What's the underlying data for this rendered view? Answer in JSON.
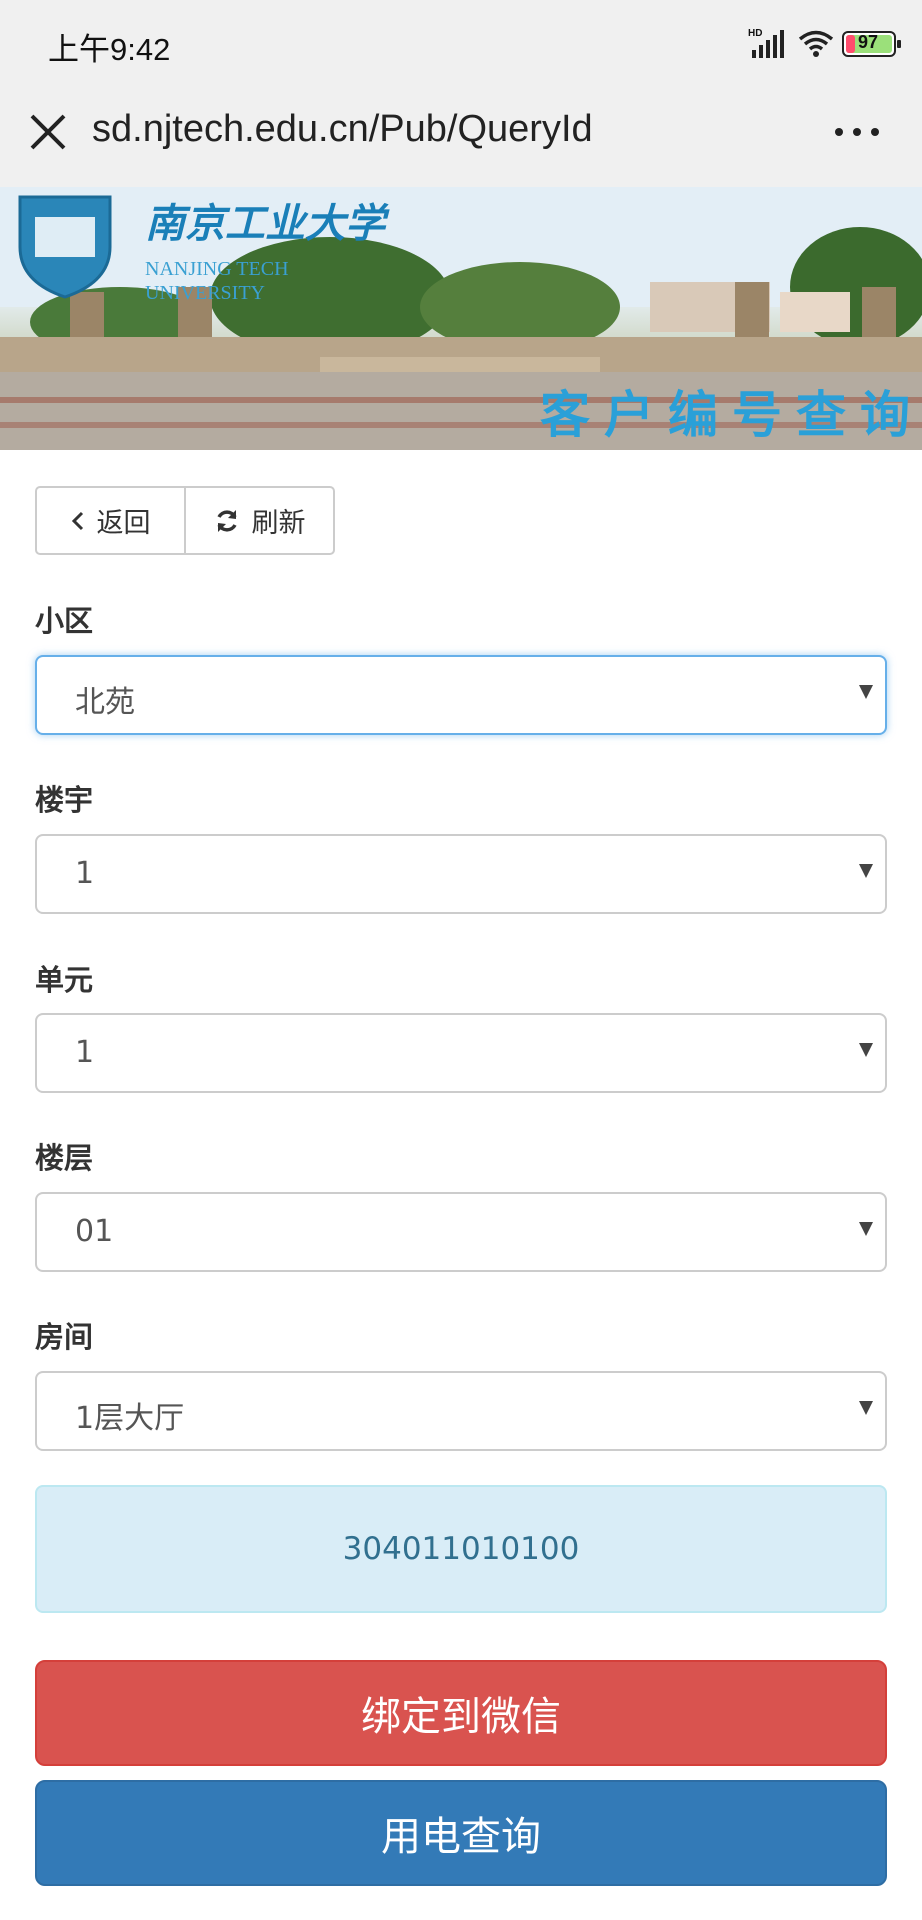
{
  "status_bar": {
    "time": "上午9:42",
    "signal_label": "HD",
    "battery": "97"
  },
  "browser": {
    "url": "sd.njtech.edu.cn/Pub/QueryId",
    "close_icon": "close-icon",
    "more_icon": "more-dots-icon"
  },
  "banner": {
    "school_name_cn": "南京工业大学",
    "school_name_en_1": "NANJING TECH",
    "school_name_en_2": "UNIVERSITY",
    "page_heading": "客户编号查询"
  },
  "toolbar": {
    "back_label": "返回",
    "refresh_label": "刷新"
  },
  "form": {
    "community": {
      "label": "小区",
      "value": "北苑"
    },
    "building": {
      "label": "楼宇",
      "value": "1"
    },
    "unit": {
      "label": "单元",
      "value": "1"
    },
    "floor": {
      "label": "楼层",
      "value": "01"
    },
    "room": {
      "label": "房间",
      "value": "1层大厅"
    }
  },
  "result": {
    "customer_id": "304011010100"
  },
  "actions": {
    "bind_label": "绑定到微信",
    "query_label": "用电查询"
  },
  "colors": {
    "bind_button": "#d9534f",
    "query_button": "#337ab7",
    "result_bg": "#d9edf7",
    "focus_border": "#66afe9"
  }
}
